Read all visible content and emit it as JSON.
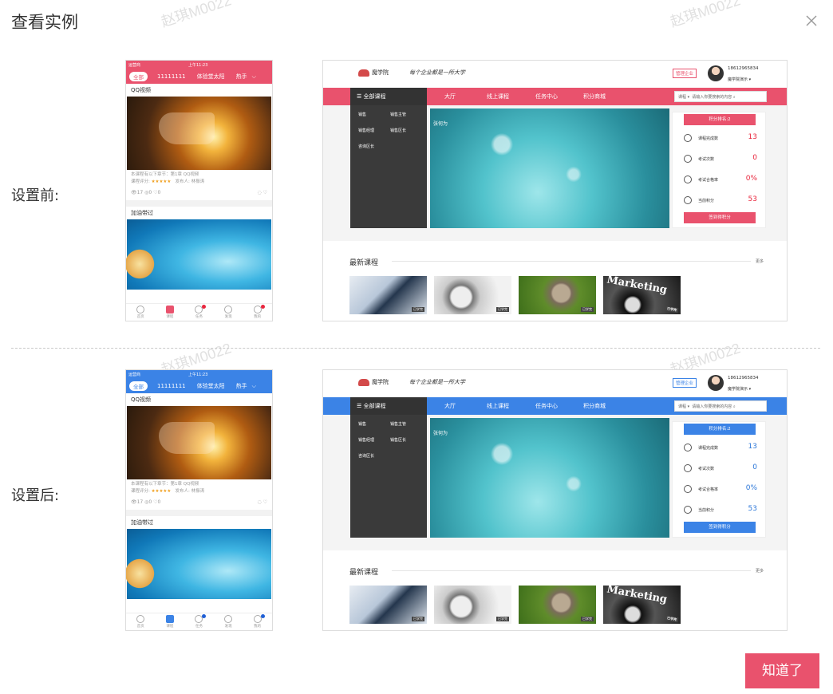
{
  "dialog": {
    "title": "查看实例",
    "confirm_label": "知道了",
    "watermark": "赵琪M0022"
  },
  "rows": [
    {
      "label": "设置前:",
      "theme": "pink",
      "accent": "#e9526d"
    },
    {
      "label": "设置后:",
      "theme": "blue",
      "accent": "#3b83e6"
    }
  ],
  "mobile": {
    "status_carrier": "运营商",
    "status_time": "上午11:23",
    "tabs": [
      "全部",
      "11111111",
      "体验堂太阳",
      "热手"
    ],
    "section1": "QQ视频",
    "meta_line1": "本课程有以下章节：第1章 QQ视频",
    "meta_line2_label": "课程评分:",
    "meta_stars": "★★★★★",
    "meta_publisher": "发布人: 林振涛",
    "meta_counts": "👁17 ◎0 ♡0",
    "section2": "加油带过",
    "nav": [
      "首页",
      "课程",
      "任务",
      "发现",
      "我的"
    ]
  },
  "desktop": {
    "logo_text": "魔学院",
    "slogan": "每个企业都是一所大学",
    "manage_button": "管理企业",
    "phone": "18612965834",
    "user_name": "魔学院演示",
    "all_courses": "☰ 全部课程",
    "nav": [
      "大厅",
      "线上课程",
      "任务中心",
      "积分商城"
    ],
    "search_scope": "课程 ▾",
    "search_placeholder": "请输入你要搜索的内容",
    "menu": [
      "销售",
      "销售主管",
      "销售经理",
      "销售区长",
      "咨询区长"
    ],
    "banner_caption": "张何为",
    "rank_label": "积分排名:2",
    "stats": [
      {
        "label": "课程完成数",
        "value": "13"
      },
      {
        "label": "考试次数",
        "value": "0"
      },
      {
        "label": "考试合格率",
        "value": "0%"
      },
      {
        "label": "当前积分",
        "value": "53"
      }
    ],
    "sign_label": "签到得积分",
    "latest_title": "最新课程",
    "more": "更多",
    "thumb_badge": "已学完",
    "thumb4_text": "Marketing"
  },
  "icons": {
    "close": "close-icon"
  }
}
